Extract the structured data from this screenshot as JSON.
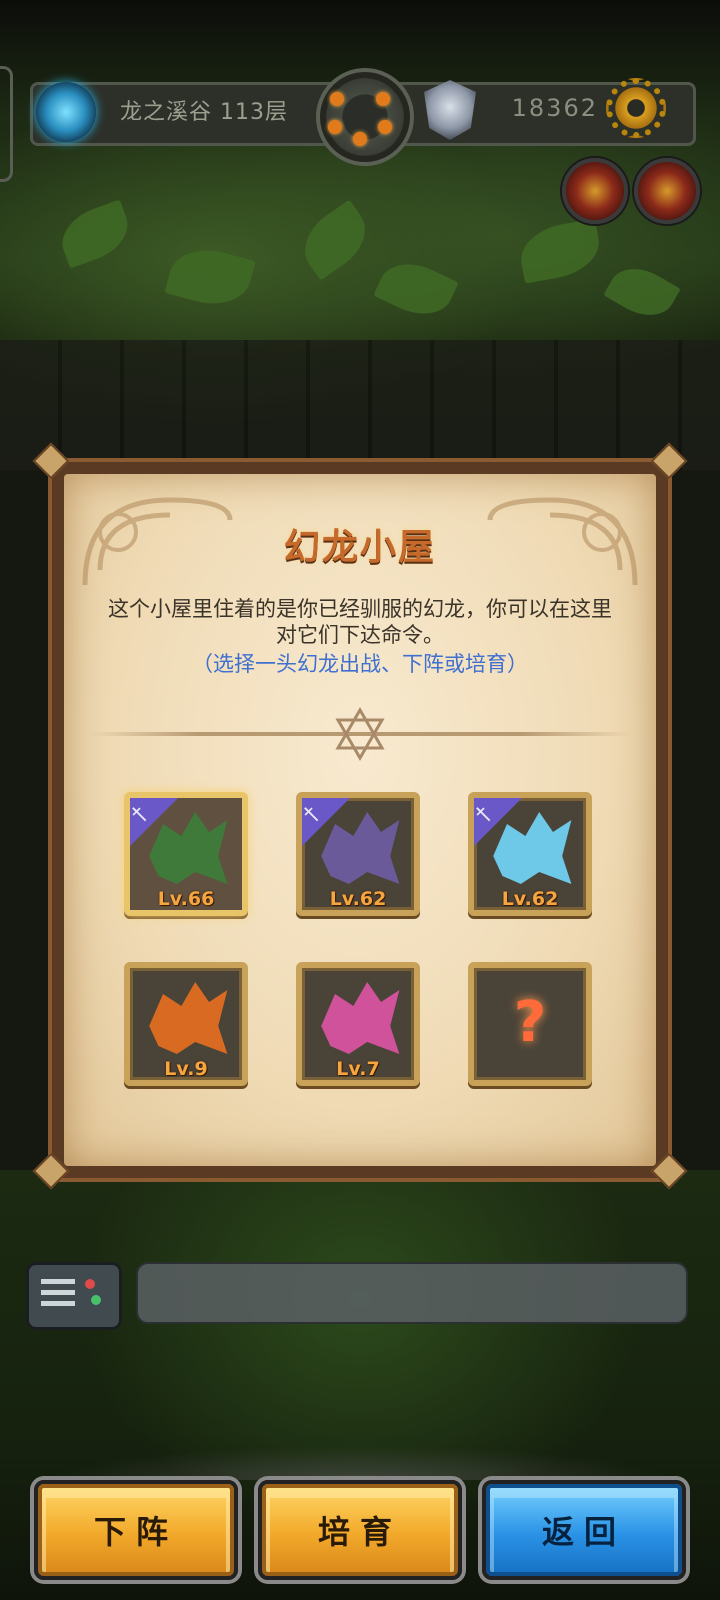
{
  "header": {
    "floor_label": "龙之溪谷 113层",
    "score": "18362",
    "icons": [
      "portal-icon",
      "wheel-icon",
      "crest-icon",
      "gear-icon"
    ]
  },
  "side_buttons": [
    "shop-icon",
    "character-icon"
  ],
  "dialog": {
    "title": "幻龙小屋",
    "description": "这个小屋里住着的是你已经驯服的幻龙，你可以在这里对它们下达命令。",
    "hint": "（选择一头幻龙出战、下阵或培育）",
    "dragons": [
      {
        "level": "Lv.66",
        "deployed": true,
        "selected": true,
        "color": "#3f7a3a"
      },
      {
        "level": "Lv.62",
        "deployed": true,
        "selected": false,
        "color": "#6b5a9a"
      },
      {
        "level": "Lv.62",
        "deployed": true,
        "selected": false,
        "color": "#6ec8e8"
      },
      {
        "level": "Lv.9",
        "deployed": false,
        "selected": false,
        "color": "#d86a22"
      },
      {
        "level": "Lv.7",
        "deployed": false,
        "selected": false,
        "color": "#d0529a"
      },
      {
        "level": "?",
        "locked": true
      }
    ]
  },
  "chat": {
    "icon": "chat-icon",
    "input_value": ""
  },
  "buttons": {
    "withdraw": "下阵",
    "train": "培育",
    "back": "返回"
  },
  "colors": {
    "accent_gold": "#f2a92a",
    "accent_blue": "#2a92e6",
    "hint_blue": "#3e6fd1",
    "level_orange": "#f6a640"
  }
}
